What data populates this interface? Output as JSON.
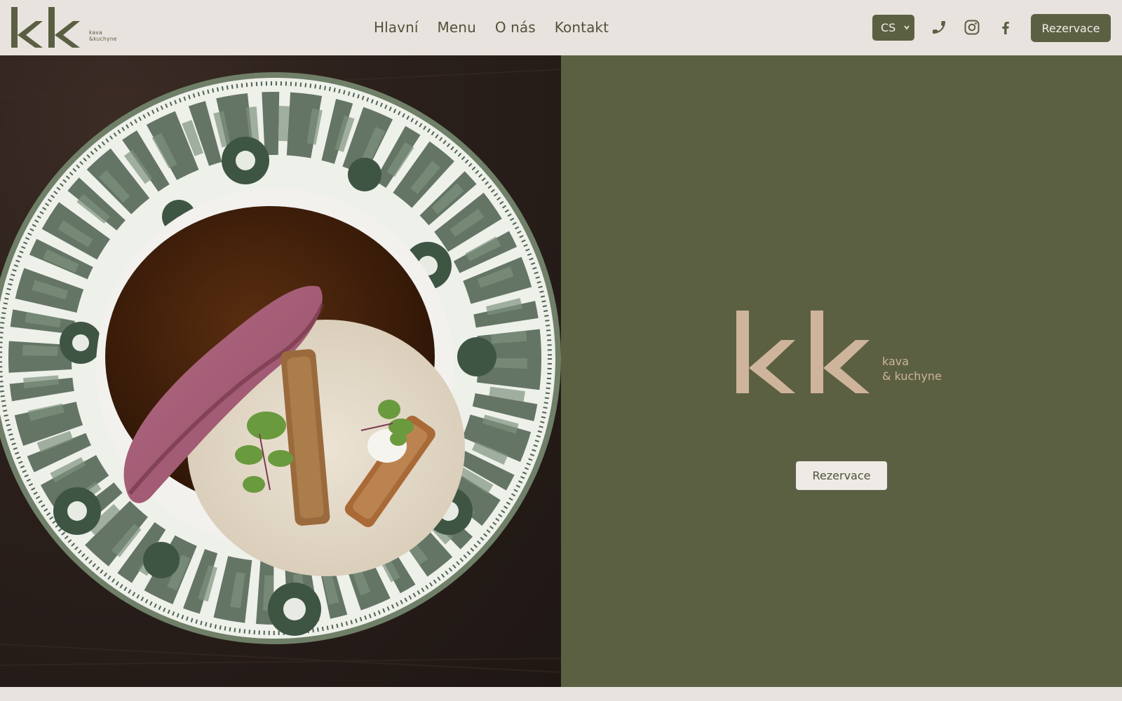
{
  "header": {
    "logo_text": "kk",
    "logo_sub_line1": "kava",
    "logo_sub_line2": "&kuchyne",
    "nav": [
      "Hlavní",
      "Menu",
      "O nás",
      "Kontakt"
    ],
    "language": "CS",
    "icons": [
      "phone-icon",
      "instagram-icon",
      "facebook-icon"
    ],
    "cta_label": "Rezervace"
  },
  "hero": {
    "photo_description": "plated dish on floral porcelain plate",
    "logo_text": "kk",
    "sub_line1": "kava",
    "sub_line2": "& kuchyne",
    "cta_label": "Rezervace"
  },
  "colors": {
    "olive": "#5c6043",
    "cream": "#e8e3de",
    "tan": "#cdb49a",
    "dark_text": "#4f5238"
  }
}
